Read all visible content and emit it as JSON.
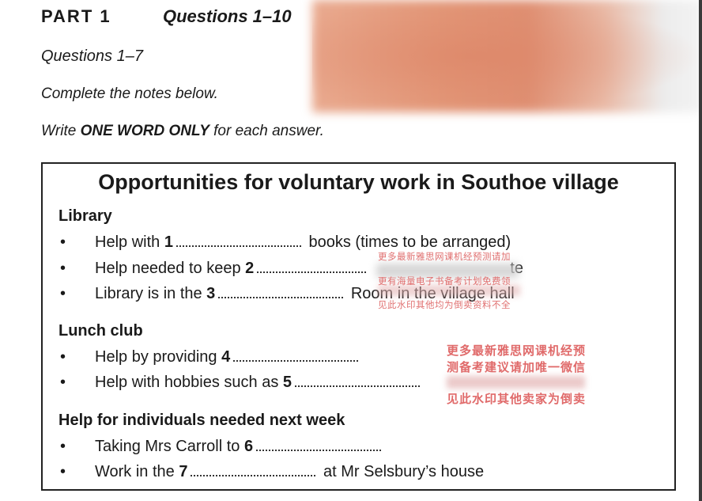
{
  "header": {
    "part": "PART 1",
    "questions": "Questions 1–10",
    "subheading": "Questions 1–7",
    "instruction_1": "Complete the notes below.",
    "instruction_2_pre": "Write ",
    "instruction_2_bold": "ONE WORD ONLY",
    "instruction_2_post": " for each answer."
  },
  "notes": {
    "title": "Opportunities for voluntary work in Southoe village",
    "sections": [
      {
        "heading": "Library",
        "items": [
          {
            "pre": "Help with ",
            "num": "1",
            "post": " books (times to be arranged)"
          },
          {
            "pre": "Help needed to keep ",
            "num": "2",
            "post": "te"
          },
          {
            "pre": "Library is in the ",
            "num": "3",
            "post": " Room in the village hall"
          }
        ]
      },
      {
        "heading": "Lunch club",
        "items": [
          {
            "pre": "Help by providing ",
            "num": "4",
            "post": ""
          },
          {
            "pre": "Help with hobbies such as ",
            "num": "5",
            "post": ""
          }
        ]
      },
      {
        "heading": "Help for individuals needed next week",
        "items": [
          {
            "pre": "Taking Mrs Carroll to ",
            "num": "6",
            "post": ""
          },
          {
            "pre": "Work in the ",
            "num": "7",
            "post": " at Mr Selsbury’s house"
          }
        ]
      }
    ],
    "bullet": "•"
  },
  "watermarks": {
    "small_1": "更多最新雅思网课机经预测请加",
    "small_2": "更有海量电子书备考计划免费领",
    "small_3": "见此水印其他均为倒卖资料不全",
    "big_1": "更多最新雅思网课机经预",
    "big_2": "测备考建议请加唯一微信",
    "big_3": "见此水印其他卖家为倒卖"
  }
}
